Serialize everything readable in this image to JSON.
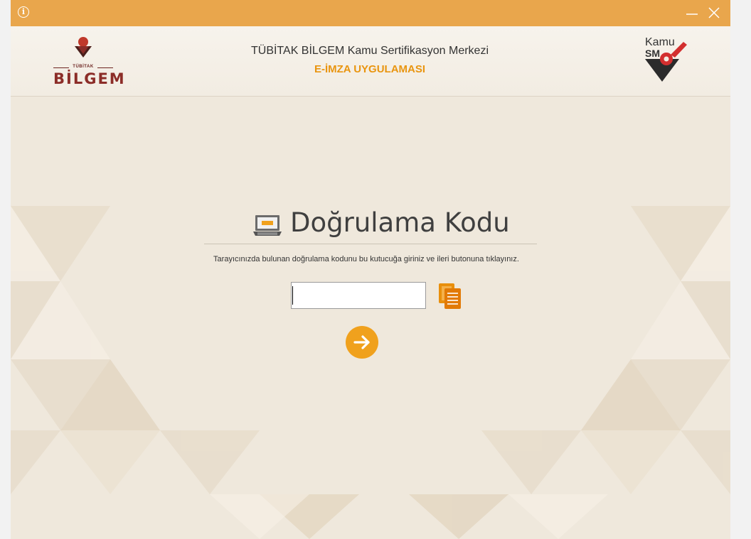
{
  "titlebar": {
    "info_icon": "info-icon",
    "minimize_label": "—",
    "close_label": "×"
  },
  "header": {
    "left_logo": {
      "top_text": "TÜBİTAK",
      "main_text": "BİLGEM"
    },
    "title": "TÜBİTAK BİLGEM Kamu Sertifikasyon Merkezi",
    "subtitle": "E-İMZA UYGULAMASI",
    "right_logo": {
      "line1": "Kamu",
      "line2": "SM"
    }
  },
  "main": {
    "title_icon": "keyboard-icon",
    "title": "Doğrulama Kodu",
    "instruction": "Tarayıcınızda bulunan doğrulama kodunu bu kutucuğa giriniz ve ileri butonuna tıklayınız.",
    "code_input": {
      "value": "",
      "placeholder": ""
    },
    "paste_icon": "paste-icon",
    "next_icon": "arrow-right-icon"
  },
  "colors": {
    "accent": "#e9a64c",
    "brand_orange": "#f0a11d",
    "subtitle": "#e9950f",
    "bilgem_red": "#8c2d28"
  }
}
